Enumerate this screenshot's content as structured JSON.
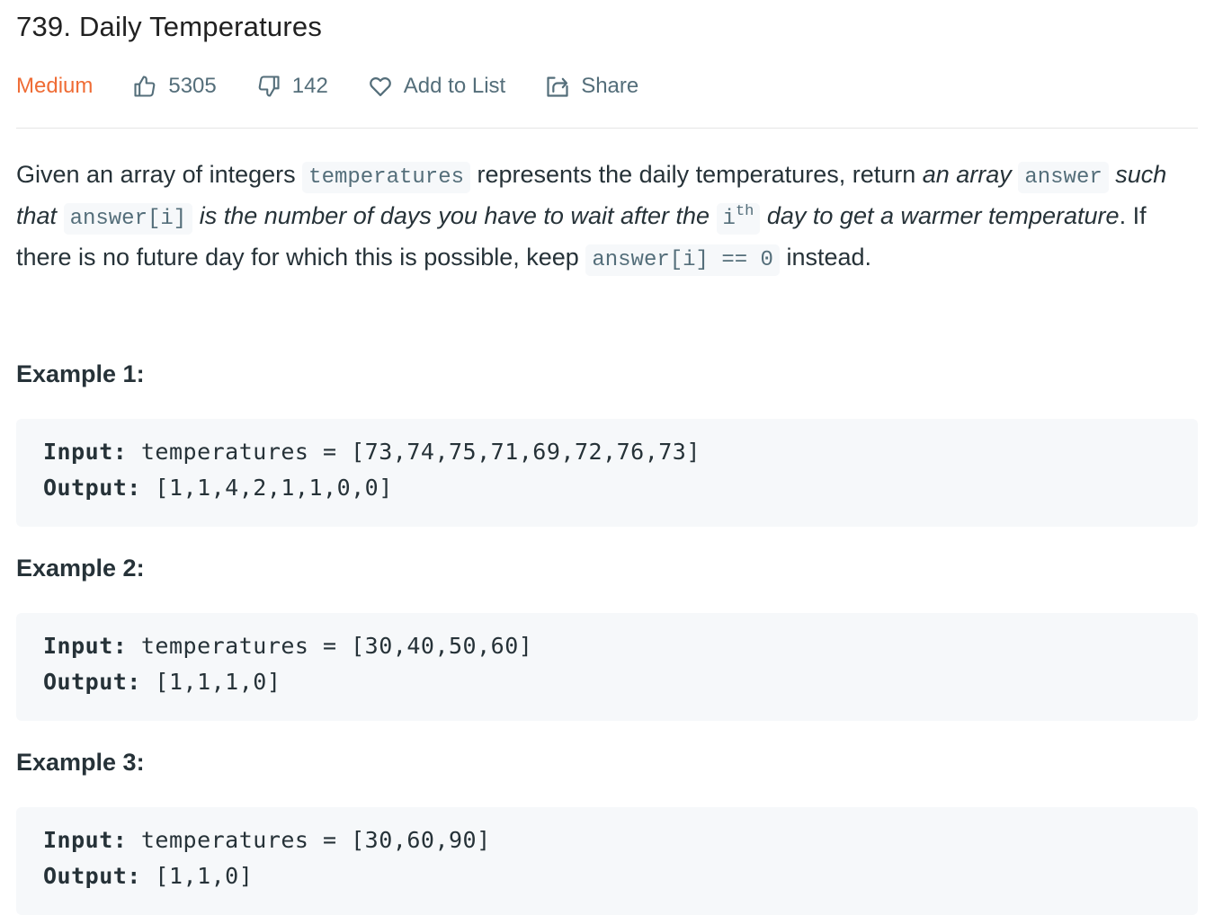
{
  "problem": {
    "title": "739. Daily Temperatures",
    "difficulty": "Medium",
    "likes": "5305",
    "dislikes": "142",
    "add_to_list_label": "Add to List",
    "share_label": "Share",
    "difficulty_color": "#ef6c35"
  },
  "description": {
    "p1": "Given an array of integers ",
    "c1": "temperatures",
    "p2": " represents the daily temperatures, return ",
    "i1": "an array",
    "c2": "answer",
    "i2": "such that",
    "c3": "answer[i]",
    "i3": "is the number of days you have to wait after the",
    "c4": "i",
    "c4_sup": "th",
    "i4": "day to get a warmer temperature",
    "p3": ". If there is no future day for which this is possible, keep ",
    "c5": "answer[i] == 0",
    "p4": " instead."
  },
  "examples": [
    {
      "title": "Example 1:",
      "input_label": "Input:",
      "input_value": " temperatures = [73,74,75,71,69,72,76,73]",
      "output_label": "Output:",
      "output_value": " [1,1,4,2,1,1,0,0]"
    },
    {
      "title": "Example 2:",
      "input_label": "Input:",
      "input_value": " temperatures = [30,40,50,60]",
      "output_label": "Output:",
      "output_value": " [1,1,1,0]"
    },
    {
      "title": "Example 3:",
      "input_label": "Input:",
      "input_value": " temperatures = [30,60,90]",
      "output_label": "Output:",
      "output_value": " [1,1,0]"
    }
  ]
}
